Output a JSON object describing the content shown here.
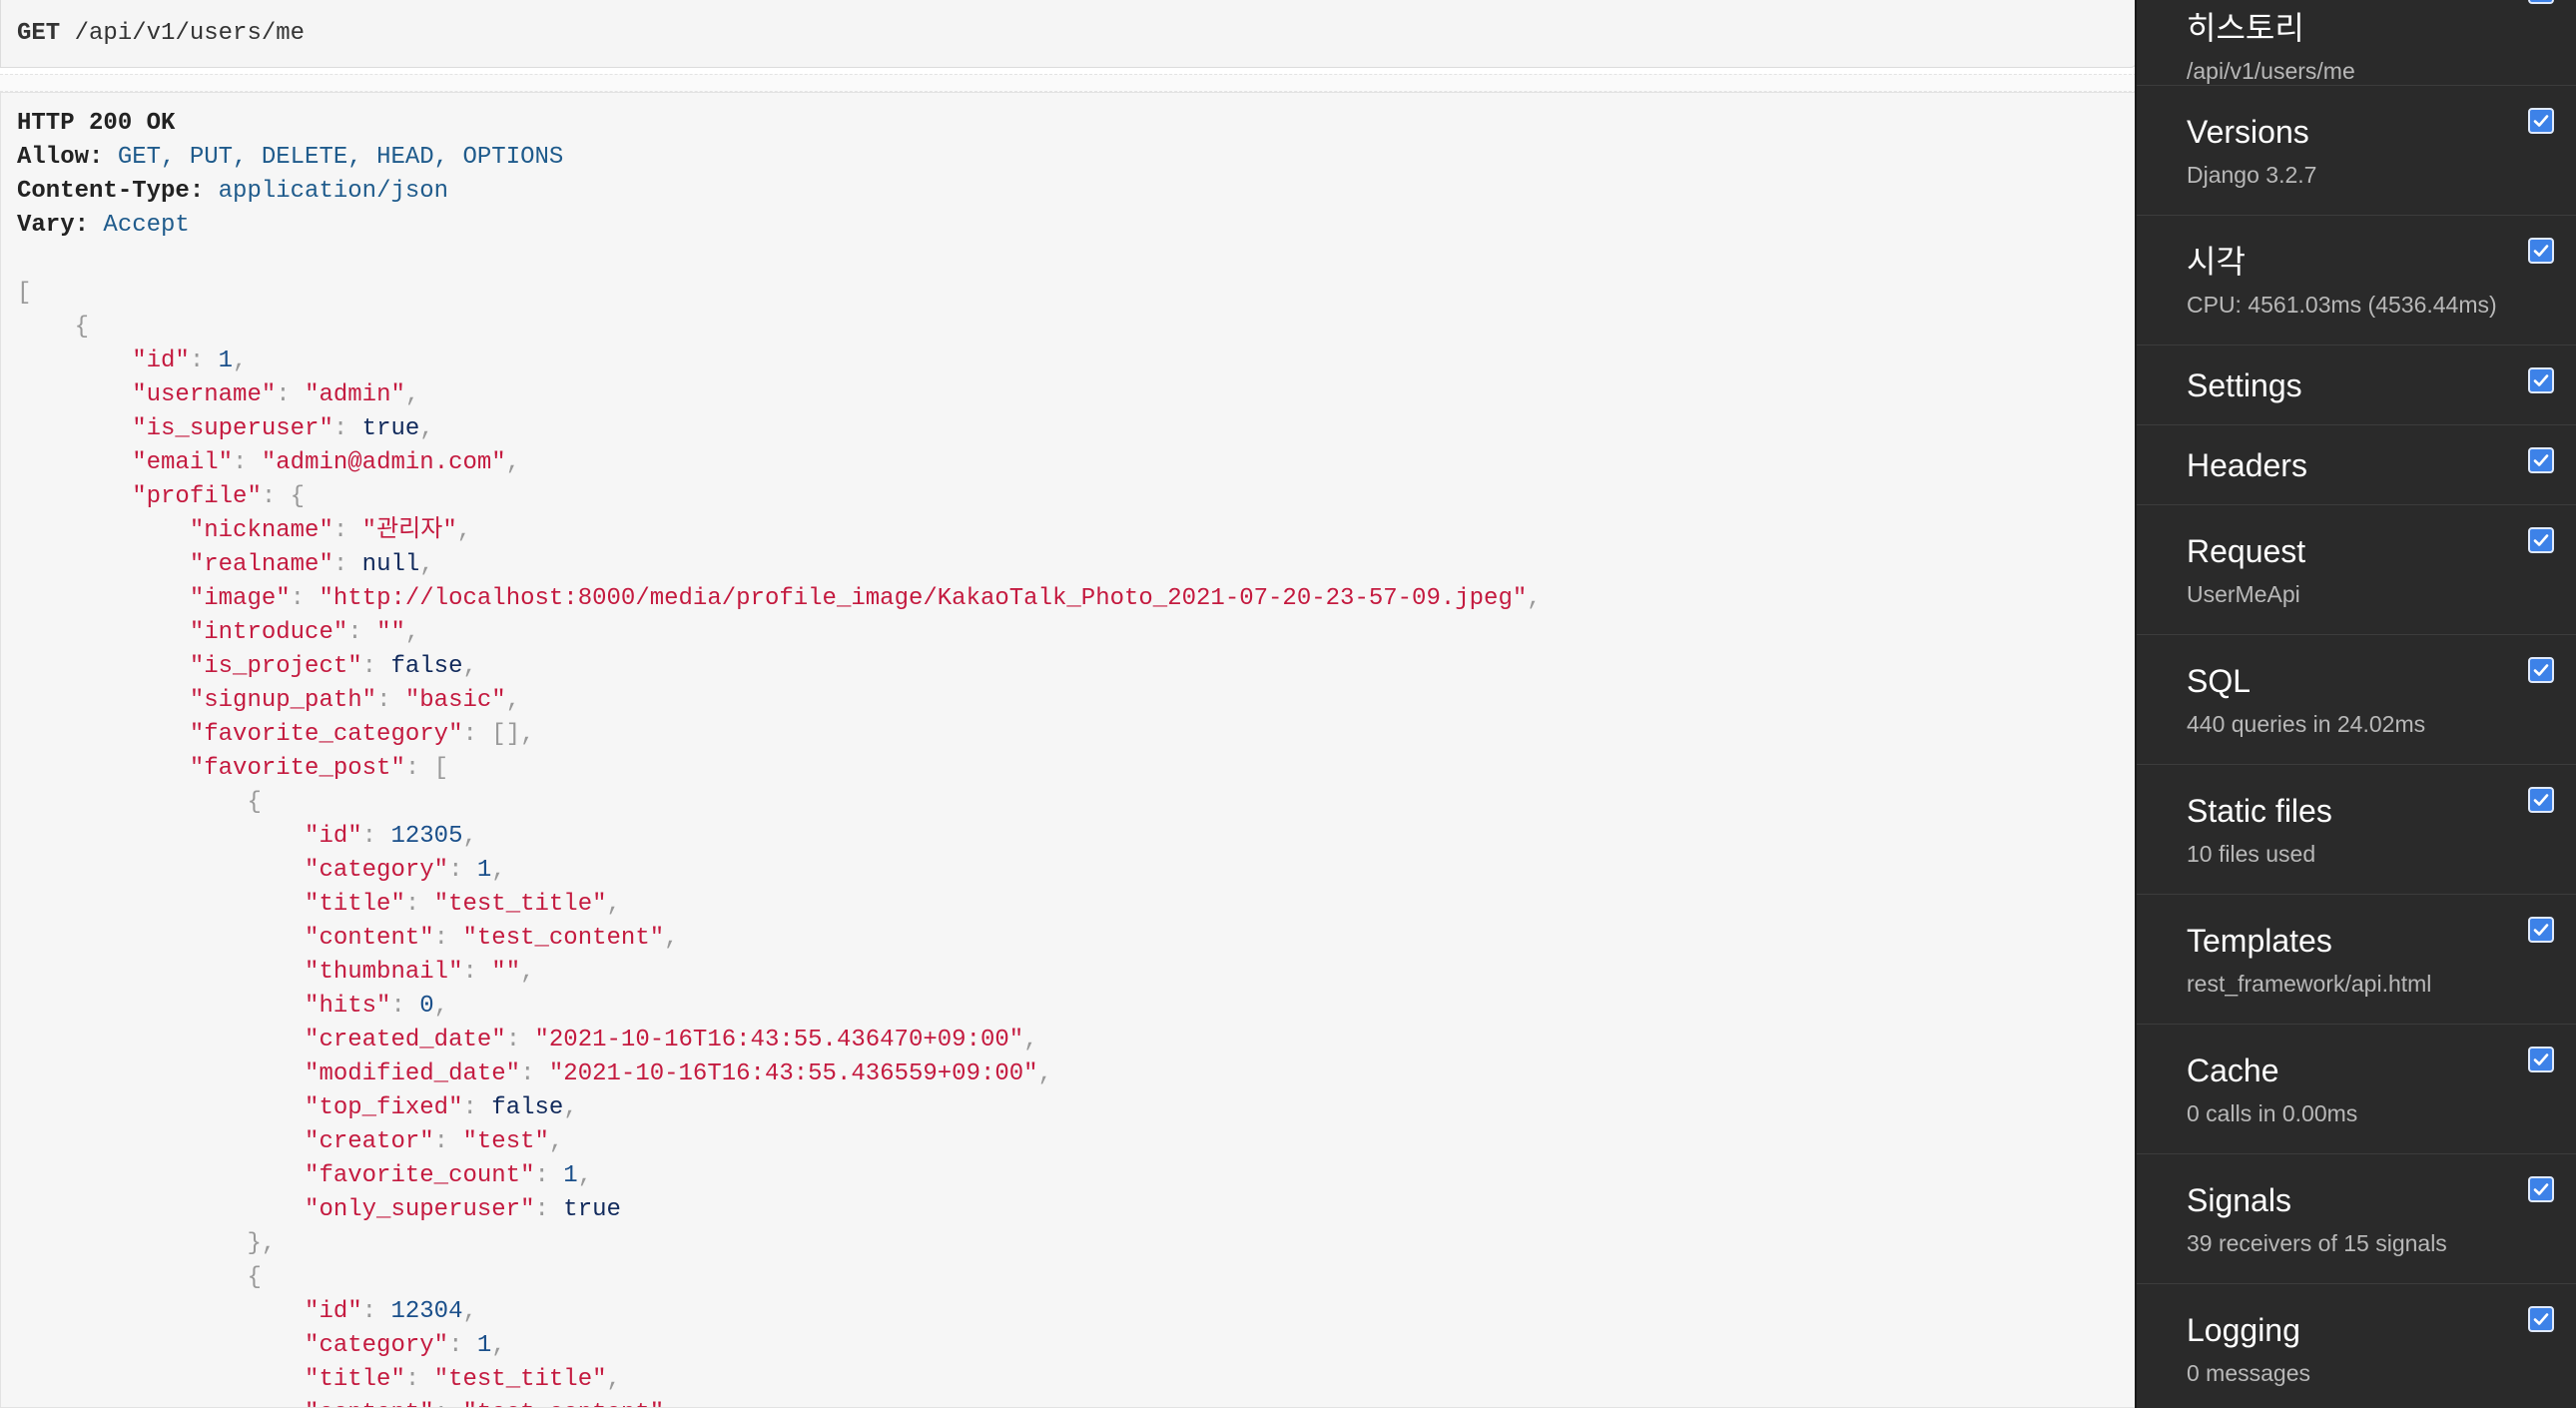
{
  "request": {
    "method": "GET",
    "path": "/api/v1/users/me"
  },
  "response": {
    "status": "HTTP 200 OK",
    "headers": [
      {
        "key": "Allow:",
        "value": "GET, PUT, DELETE, HEAD, OPTIONS"
      },
      {
        "key": "Content-Type:",
        "value": "application/json"
      },
      {
        "key": "Vary:",
        "value": "Accept"
      }
    ],
    "body_lines": [
      {
        "indent": 0,
        "t": [
          {
            "c": "p",
            "v": "["
          }
        ]
      },
      {
        "indent": 1,
        "t": [
          {
            "c": "p",
            "v": "{"
          }
        ]
      },
      {
        "indent": 2,
        "t": [
          {
            "c": "k",
            "v": "\"id\""
          },
          {
            "c": "p",
            "v": ": "
          },
          {
            "c": "n",
            "v": "1"
          },
          {
            "c": "p",
            "v": ","
          }
        ]
      },
      {
        "indent": 2,
        "t": [
          {
            "c": "k",
            "v": "\"username\""
          },
          {
            "c": "p",
            "v": ": "
          },
          {
            "c": "s",
            "v": "\"admin\""
          },
          {
            "c": "p",
            "v": ","
          }
        ]
      },
      {
        "indent": 2,
        "t": [
          {
            "c": "k",
            "v": "\"is_superuser\""
          },
          {
            "c": "p",
            "v": ": "
          },
          {
            "c": "lit",
            "v": "true"
          },
          {
            "c": "p",
            "v": ","
          }
        ]
      },
      {
        "indent": 2,
        "t": [
          {
            "c": "k",
            "v": "\"email\""
          },
          {
            "c": "p",
            "v": ": "
          },
          {
            "c": "s",
            "v": "\"admin@admin.com\""
          },
          {
            "c": "p",
            "v": ","
          }
        ]
      },
      {
        "indent": 2,
        "t": [
          {
            "c": "k",
            "v": "\"profile\""
          },
          {
            "c": "p",
            "v": ": {"
          }
        ]
      },
      {
        "indent": 3,
        "t": [
          {
            "c": "k",
            "v": "\"nickname\""
          },
          {
            "c": "p",
            "v": ": "
          },
          {
            "c": "s",
            "v": "\"관리자\""
          },
          {
            "c": "p",
            "v": ","
          }
        ]
      },
      {
        "indent": 3,
        "t": [
          {
            "c": "k",
            "v": "\"realname\""
          },
          {
            "c": "p",
            "v": ": "
          },
          {
            "c": "lit",
            "v": "null"
          },
          {
            "c": "p",
            "v": ","
          }
        ]
      },
      {
        "indent": 3,
        "t": [
          {
            "c": "k",
            "v": "\"image\""
          },
          {
            "c": "p",
            "v": ": "
          },
          {
            "c": "s",
            "v": "\"http://localhost:8000/media/profile_image/KakaoTalk_Photo_2021-07-20-23-57-09.jpeg\""
          },
          {
            "c": "p",
            "v": ","
          }
        ]
      },
      {
        "indent": 3,
        "t": [
          {
            "c": "k",
            "v": "\"introduce\""
          },
          {
            "c": "p",
            "v": ": "
          },
          {
            "c": "s",
            "v": "\"\""
          },
          {
            "c": "p",
            "v": ","
          }
        ]
      },
      {
        "indent": 3,
        "t": [
          {
            "c": "k",
            "v": "\"is_project\""
          },
          {
            "c": "p",
            "v": ": "
          },
          {
            "c": "lit",
            "v": "false"
          },
          {
            "c": "p",
            "v": ","
          }
        ]
      },
      {
        "indent": 3,
        "t": [
          {
            "c": "k",
            "v": "\"signup_path\""
          },
          {
            "c": "p",
            "v": ": "
          },
          {
            "c": "s",
            "v": "\"basic\""
          },
          {
            "c": "p",
            "v": ","
          }
        ]
      },
      {
        "indent": 3,
        "t": [
          {
            "c": "k",
            "v": "\"favorite_category\""
          },
          {
            "c": "p",
            "v": ": [],"
          }
        ]
      },
      {
        "indent": 3,
        "t": [
          {
            "c": "k",
            "v": "\"favorite_post\""
          },
          {
            "c": "p",
            "v": ": ["
          }
        ]
      },
      {
        "indent": 4,
        "t": [
          {
            "c": "p",
            "v": "{"
          }
        ]
      },
      {
        "indent": 5,
        "t": [
          {
            "c": "k",
            "v": "\"id\""
          },
          {
            "c": "p",
            "v": ": "
          },
          {
            "c": "n",
            "v": "12305"
          },
          {
            "c": "p",
            "v": ","
          }
        ]
      },
      {
        "indent": 5,
        "t": [
          {
            "c": "k",
            "v": "\"category\""
          },
          {
            "c": "p",
            "v": ": "
          },
          {
            "c": "n",
            "v": "1"
          },
          {
            "c": "p",
            "v": ","
          }
        ]
      },
      {
        "indent": 5,
        "t": [
          {
            "c": "k",
            "v": "\"title\""
          },
          {
            "c": "p",
            "v": ": "
          },
          {
            "c": "s",
            "v": "\"test_title\""
          },
          {
            "c": "p",
            "v": ","
          }
        ]
      },
      {
        "indent": 5,
        "t": [
          {
            "c": "k",
            "v": "\"content\""
          },
          {
            "c": "p",
            "v": ": "
          },
          {
            "c": "s",
            "v": "\"test_content\""
          },
          {
            "c": "p",
            "v": ","
          }
        ]
      },
      {
        "indent": 5,
        "t": [
          {
            "c": "k",
            "v": "\"thumbnail\""
          },
          {
            "c": "p",
            "v": ": "
          },
          {
            "c": "s",
            "v": "\"\""
          },
          {
            "c": "p",
            "v": ","
          }
        ]
      },
      {
        "indent": 5,
        "t": [
          {
            "c": "k",
            "v": "\"hits\""
          },
          {
            "c": "p",
            "v": ": "
          },
          {
            "c": "n",
            "v": "0"
          },
          {
            "c": "p",
            "v": ","
          }
        ]
      },
      {
        "indent": 5,
        "t": [
          {
            "c": "k",
            "v": "\"created_date\""
          },
          {
            "c": "p",
            "v": ": "
          },
          {
            "c": "s",
            "v": "\"2021-10-16T16:43:55.436470+09:00\""
          },
          {
            "c": "p",
            "v": ","
          }
        ]
      },
      {
        "indent": 5,
        "t": [
          {
            "c": "k",
            "v": "\"modified_date\""
          },
          {
            "c": "p",
            "v": ": "
          },
          {
            "c": "s",
            "v": "\"2021-10-16T16:43:55.436559+09:00\""
          },
          {
            "c": "p",
            "v": ","
          }
        ]
      },
      {
        "indent": 5,
        "t": [
          {
            "c": "k",
            "v": "\"top_fixed\""
          },
          {
            "c": "p",
            "v": ": "
          },
          {
            "c": "lit",
            "v": "false"
          },
          {
            "c": "p",
            "v": ","
          }
        ]
      },
      {
        "indent": 5,
        "t": [
          {
            "c": "k",
            "v": "\"creator\""
          },
          {
            "c": "p",
            "v": ": "
          },
          {
            "c": "s",
            "v": "\"test\""
          },
          {
            "c": "p",
            "v": ","
          }
        ]
      },
      {
        "indent": 5,
        "t": [
          {
            "c": "k",
            "v": "\"favorite_count\""
          },
          {
            "c": "p",
            "v": ": "
          },
          {
            "c": "n",
            "v": "1"
          },
          {
            "c": "p",
            "v": ","
          }
        ]
      },
      {
        "indent": 5,
        "t": [
          {
            "c": "k",
            "v": "\"only_superuser\""
          },
          {
            "c": "p",
            "v": ": "
          },
          {
            "c": "lit",
            "v": "true"
          }
        ]
      },
      {
        "indent": 4,
        "t": [
          {
            "c": "p",
            "v": "},"
          }
        ]
      },
      {
        "indent": 4,
        "t": [
          {
            "c": "p",
            "v": "{"
          }
        ]
      },
      {
        "indent": 5,
        "t": [
          {
            "c": "k",
            "v": "\"id\""
          },
          {
            "c": "p",
            "v": ": "
          },
          {
            "c": "n",
            "v": "12304"
          },
          {
            "c": "p",
            "v": ","
          }
        ]
      },
      {
        "indent": 5,
        "t": [
          {
            "c": "k",
            "v": "\"category\""
          },
          {
            "c": "p",
            "v": ": "
          },
          {
            "c": "n",
            "v": "1"
          },
          {
            "c": "p",
            "v": ","
          }
        ]
      },
      {
        "indent": 5,
        "t": [
          {
            "c": "k",
            "v": "\"title\""
          },
          {
            "c": "p",
            "v": ": "
          },
          {
            "c": "s",
            "v": "\"test_title\""
          },
          {
            "c": "p",
            "v": ","
          }
        ]
      },
      {
        "indent": 5,
        "t": [
          {
            "c": "k",
            "v": "\"content\""
          },
          {
            "c": "p",
            "v": ": "
          },
          {
            "c": "s",
            "v": "\"test_content\""
          },
          {
            "c": "p",
            "v": ","
          }
        ]
      }
    ]
  },
  "toolbar": {
    "panels": [
      {
        "id": "history",
        "title": "히스토리",
        "subtitle": "/api/v1/users/me",
        "checked": true
      },
      {
        "id": "versions",
        "title": "Versions",
        "subtitle": "Django 3.2.7",
        "checked": true
      },
      {
        "id": "time",
        "title": "시각",
        "subtitle": "CPU: 4561.03ms (4536.44ms)",
        "checked": true
      },
      {
        "id": "settings",
        "title": "Settings",
        "subtitle": "",
        "checked": true
      },
      {
        "id": "headers",
        "title": "Headers",
        "subtitle": "",
        "checked": true
      },
      {
        "id": "request",
        "title": "Request",
        "subtitle": "UserMeApi",
        "checked": true
      },
      {
        "id": "sql",
        "title": "SQL",
        "subtitle": "440 queries in 24.02ms",
        "checked": true
      },
      {
        "id": "static-files",
        "title": "Static files",
        "subtitle": "10 files used",
        "checked": true
      },
      {
        "id": "templates",
        "title": "Templates",
        "subtitle": "rest_framework/api.html",
        "checked": true
      },
      {
        "id": "cache",
        "title": "Cache",
        "subtitle": "0 calls in 0.00ms",
        "checked": true
      },
      {
        "id": "signals",
        "title": "Signals",
        "subtitle": "39 receivers of 15 signals",
        "checked": true
      },
      {
        "id": "logging",
        "title": "Logging",
        "subtitle": "0 messages",
        "checked": true
      }
    ]
  },
  "colors": {
    "key": "#c41a3f",
    "number": "#1a4f8a",
    "literal": "#112a5c",
    "punct": "#999999",
    "header_value": "#1f5b8c",
    "toolbar_bg": "#2a2a2a",
    "checkbox": "#3d82e8"
  }
}
